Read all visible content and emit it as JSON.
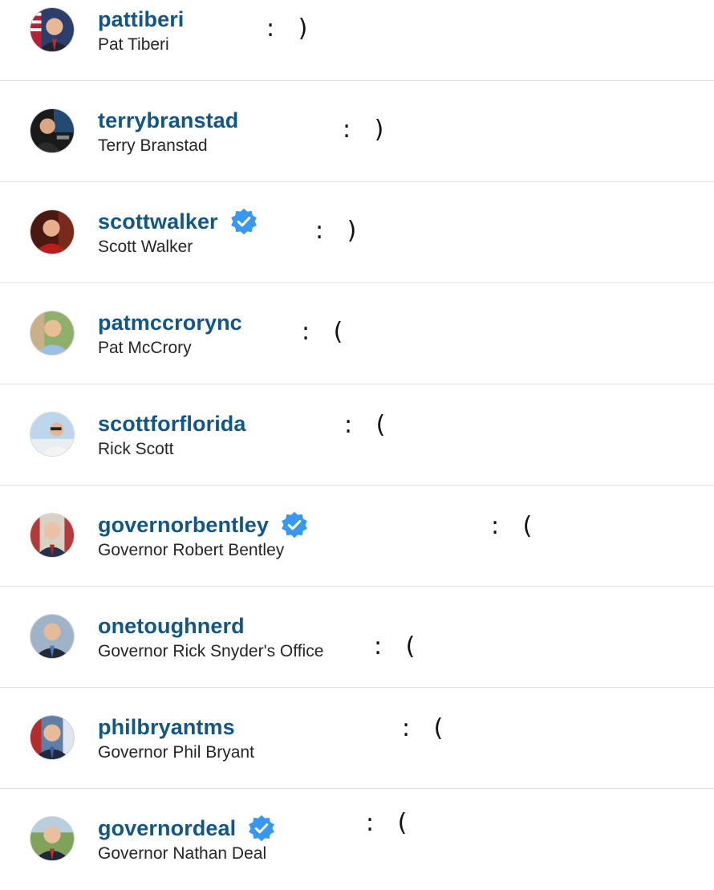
{
  "accounts": [
    {
      "username": "pattiberi",
      "full_name": "Pat Tiberi",
      "verified": false,
      "annotation": ": )"
    },
    {
      "username": "terrybranstad",
      "full_name": "Terry Branstad",
      "verified": false,
      "annotation": ": )"
    },
    {
      "username": "scottwalker",
      "full_name": "Scott Walker",
      "verified": true,
      "annotation": ": )"
    },
    {
      "username": "patmccrorync",
      "full_name": "Pat McCrory",
      "verified": false,
      "annotation": ": ("
    },
    {
      "username": "scottforflorida",
      "full_name": "Rick Scott",
      "verified": false,
      "annotation": ": ("
    },
    {
      "username": "governorbentley",
      "full_name": "Governor Robert Bentley",
      "verified": true,
      "annotation": ": ("
    },
    {
      "username": "onetoughnerd",
      "full_name": "Governor Rick Snyder's Office",
      "verified": false,
      "annotation": ": ("
    },
    {
      "username": "philbryantms",
      "full_name": "Governor Phil Bryant",
      "verified": false,
      "annotation": ": ("
    },
    {
      "username": "governordeal",
      "full_name": "Governor Nathan Deal",
      "verified": true,
      "annotation": ": ("
    }
  ],
  "colors": {
    "username": "#125688",
    "full_name": "#262626",
    "verified_badge": "#3897f0",
    "divider": "#e3e3e3"
  },
  "icons": {
    "verified": "verified-badge-icon",
    "avatar": "profile-photo"
  }
}
